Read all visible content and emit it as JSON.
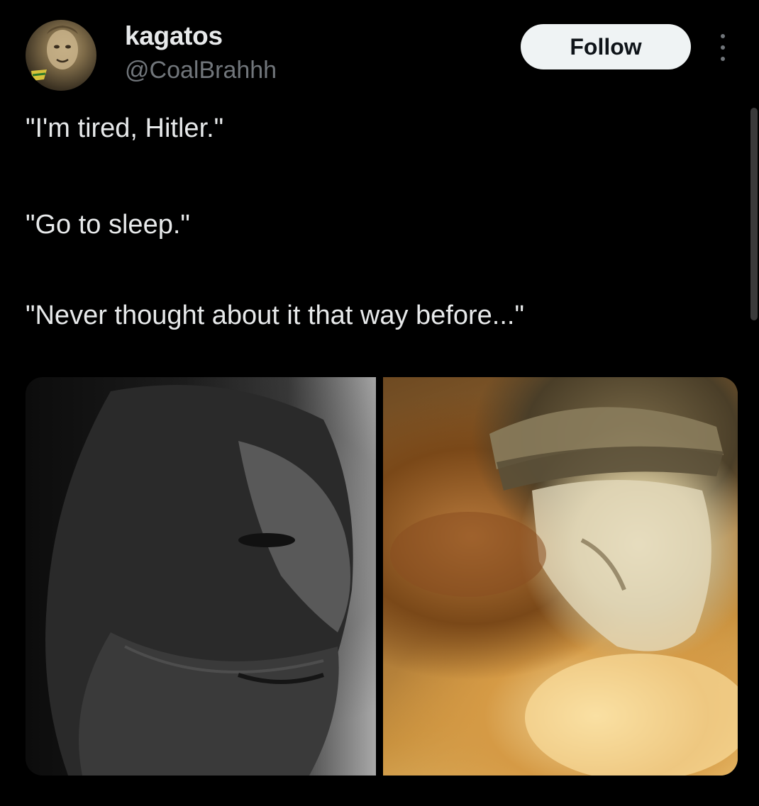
{
  "user": {
    "display_name": "kagatos",
    "handle": "@CoalBrahhh",
    "avatar_icon": "profile-avatar"
  },
  "actions": {
    "follow_label": "Follow",
    "more_icon": "more-vertical-icon"
  },
  "tweet": {
    "lines": [
      "\"I'm tired, Hitler.\"",
      "\"Go to sleep.\"",
      "\"Never thought about it that way before...\""
    ]
  },
  "colors": {
    "background": "#000000",
    "text_primary": "#e7e9ea",
    "text_secondary": "#71767b",
    "follow_button_bg": "#eff3f4",
    "follow_button_text": "#0f1419"
  }
}
